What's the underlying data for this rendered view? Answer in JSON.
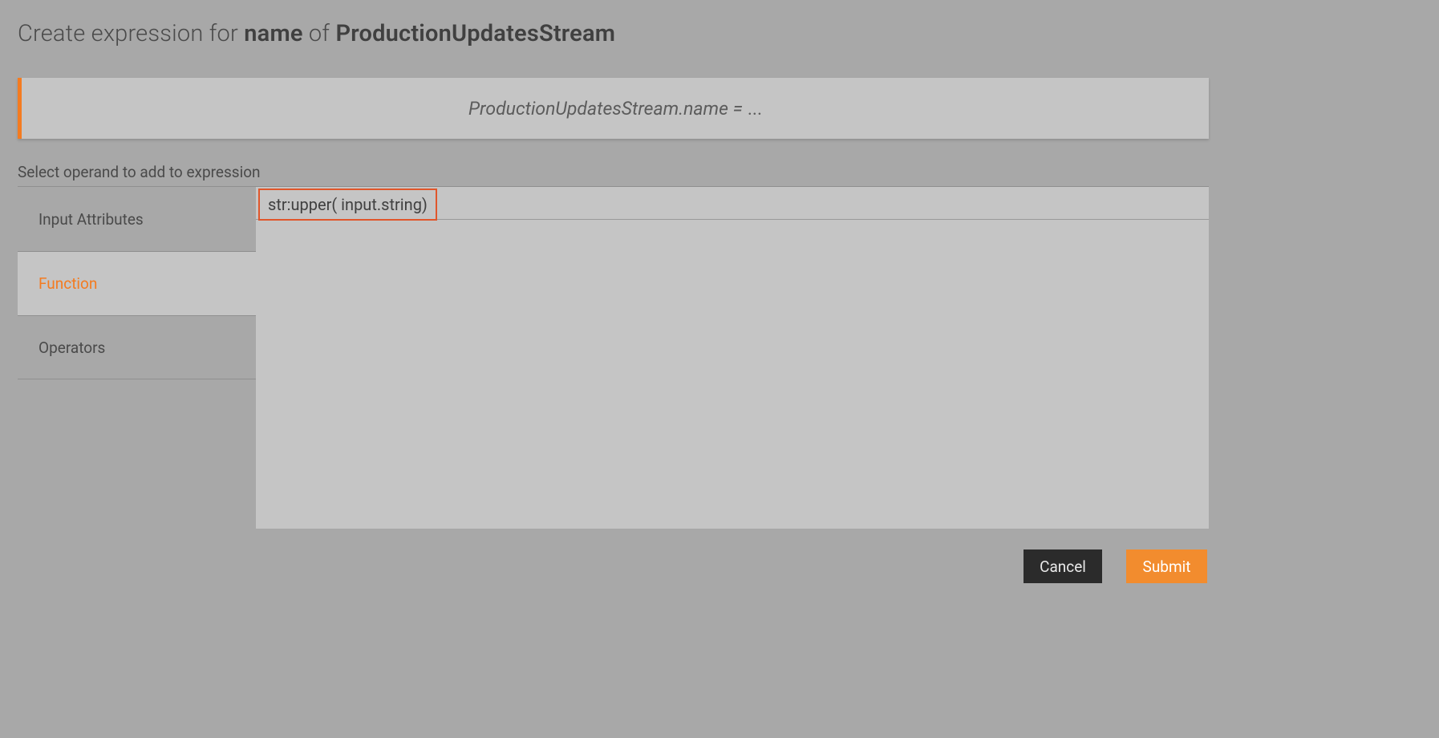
{
  "title": {
    "prefix": "Create expression for ",
    "attribute": "name",
    "middle": " of ",
    "stream": "ProductionUpdatesStream"
  },
  "expression": {
    "lhs": "ProductionUpdatesStream.name = ",
    "rhs": "..."
  },
  "section_label": "Select operand to add to expression",
  "tabs": {
    "input_attributes": "Input Attributes",
    "function": "Function",
    "operators": "Operators"
  },
  "functions": {
    "items": [
      "str:upper( input.string)"
    ]
  },
  "buttons": {
    "cancel": "Cancel",
    "submit": "Submit"
  }
}
